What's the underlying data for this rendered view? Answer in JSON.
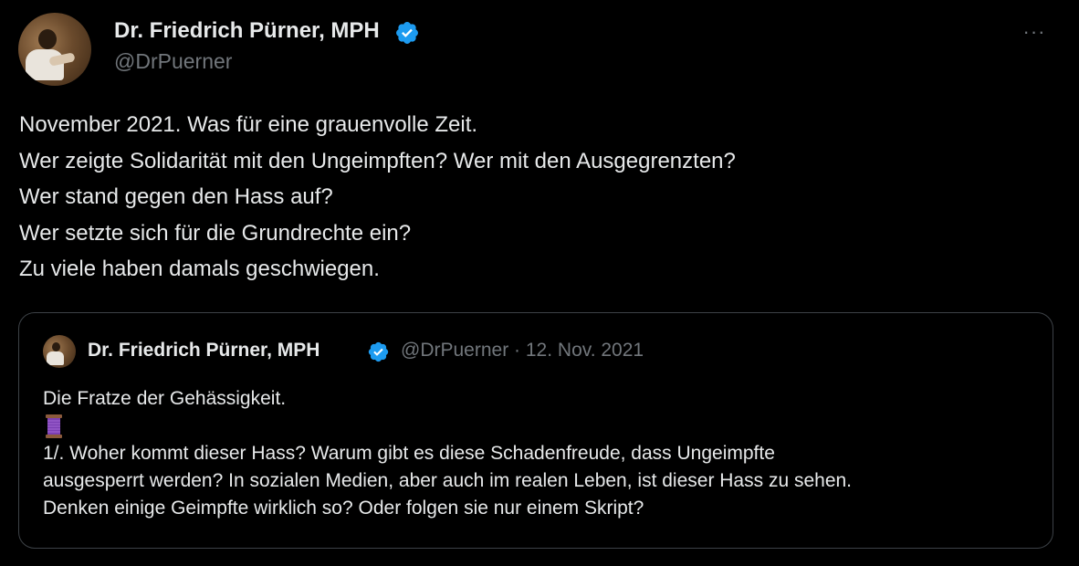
{
  "tweet": {
    "author": {
      "name": "Dr. Friedrich Pürner, MPH",
      "handle": "@DrPuerner",
      "avatar_icon": "profile-photo"
    },
    "more_icon": "more-horizontal-icon",
    "more_label": "···",
    "text_lines": [
      "November 2021. Was für eine grauenvolle Zeit.",
      "Wer zeigte Solidarität mit den Ungeimpften? Wer mit den Ausgegrenzten?",
      "Wer stand gegen den Hass auf?",
      "Wer setzte sich für die Grundrechte ein?",
      "Zu viele haben damals geschwiegen."
    ],
    "quoted": {
      "author": {
        "name": "Dr. Friedrich Pürner, MPH",
        "handle": "@DrPuerner"
      },
      "separator": "·",
      "date": "12. Nov. 2021",
      "first_line": "Die Fratze der Gehässigkeit.",
      "thread_icon": "thread-spool-emoji",
      "body_lines": [
        "1/. Woher kommt dieser Hass? Warum gibt es diese Schadenfreude, dass Ungeimpfte",
        "ausgesperrt werden? In sozialen Medien, aber auch im realen Leben, ist dieser Hass zu sehen.",
        "Denken einige Geimpfte wirklich so? Oder folgen sie nur einem Skript?"
      ]
    }
  },
  "colors": {
    "background": "#000000",
    "text_primary": "#e7e9ea",
    "text_secondary": "#71767b",
    "verified_blue": "#1d9bf0",
    "card_border": "#3d4247"
  }
}
